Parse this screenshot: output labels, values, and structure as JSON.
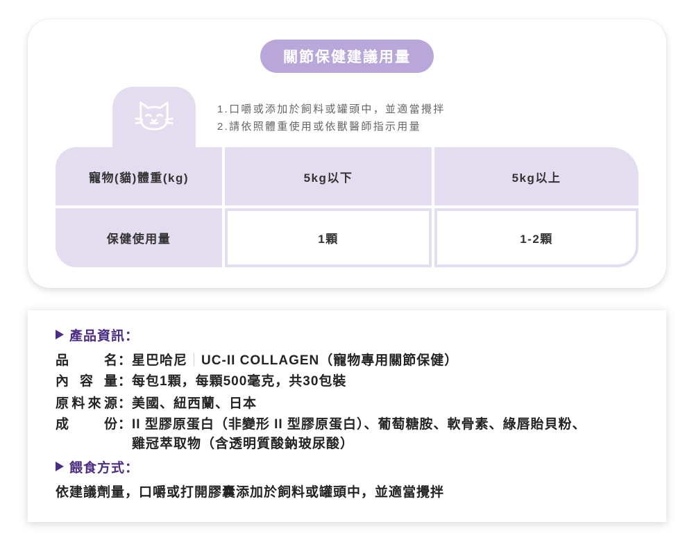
{
  "colors": {
    "accent": "#b9a7d9",
    "lavender": "#e4dcef",
    "heading_purple": "#4b2d83",
    "text": "#232323"
  },
  "dosage_card": {
    "title": "關節保健建議用量",
    "tab_icon": "cat-face-icon",
    "instructions": [
      "1.口嚼或添加於飼料或罐頭中，並適當攪拌",
      "2.請依照體重使用或依獸醫師指示用量"
    ],
    "table": {
      "weight_row": {
        "label": "寵物(貓)體重(kg)",
        "under_5kg": "5kg以下",
        "over_5kg": "5kg以上"
      },
      "dose_row": {
        "label": "保健使用量",
        "under_5kg": "1顆",
        "over_5kg": "1-2顆"
      }
    }
  },
  "product_card": {
    "bullet_icon": "triangle-right-icon",
    "info_heading": "產品資訊：",
    "colon": "：",
    "name": {
      "label": "品　　名",
      "brand": "星巴哈尼",
      "separator": "｜",
      "product": "UC-II COLLAGEN（寵物專用關節保健）"
    },
    "content": {
      "label": "內 容 量",
      "value": "每包1顆，每顆500毫克，共30包裝"
    },
    "origin": {
      "label": "原料來源",
      "value": "美國、紐西蘭、日本"
    },
    "ingredients": {
      "label": "成　　份",
      "lines": [
        "II 型膠原蛋白（非變形 II 型膠原蛋白）、葡萄糖胺、軟骨素、綠唇貽貝粉、",
        "雞冠萃取物（含透明質酸鈉玻尿酸）"
      ]
    },
    "feeding_heading": "餵食方式：",
    "feeding_text": "依建議劑量，口嚼或打開膠囊添加於飼料或罐頭中，並適當攪拌"
  }
}
